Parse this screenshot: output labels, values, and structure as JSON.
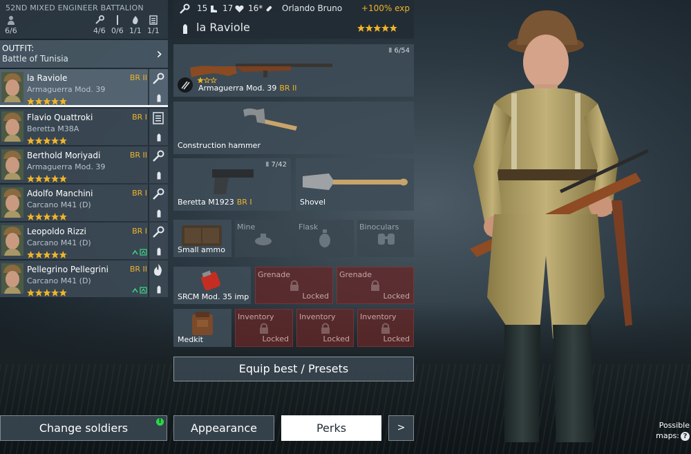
{
  "squad": {
    "title": "52ND MIXED ENGINEER BATTALION",
    "stats": [
      {
        "icon": "person-icon",
        "value": "6/6"
      },
      {
        "icon": "wrench-icon",
        "value": "4/6"
      },
      {
        "icon": "rifle-icon",
        "value": "0/6"
      },
      {
        "icon": "flame-icon",
        "value": "1/1"
      },
      {
        "icon": "list-icon",
        "value": "1/1"
      }
    ]
  },
  "outfit": {
    "label": "OUTFIT:",
    "value": "Battle of Tunisia"
  },
  "soldiers": [
    {
      "name": "la Raviole",
      "weapon": "Armaguerra Mod. 39",
      "br": "BR II",
      "role": "wrench-icon",
      "upgrade": ""
    },
    {
      "name": "Flavio Quattroki",
      "weapon": "Beretta M38A",
      "br": "BR I",
      "role": "list-icon",
      "upgrade": ""
    },
    {
      "name": "Berthold Moriyadi",
      "weapon": "Armaguerra Mod. 39",
      "br": "BR II",
      "role": "wrench-icon",
      "upgrade": ""
    },
    {
      "name": "Adolfo Manchini",
      "weapon": "Carcano M41 (D)",
      "br": "BR I",
      "role": "wrench-icon",
      "upgrade": ""
    },
    {
      "name": "Leopoldo Rizzi",
      "weapon": "Carcano M41 (D)",
      "br": "BR I",
      "role": "wrench-icon",
      "upgrade": "^"
    },
    {
      "name": "Pellegrino Pellegrini",
      "weapon": "Carcano M41 (D)",
      "br": "BR II",
      "role": "flame-icon",
      "upgrade": "^"
    }
  ],
  "change_soldiers": {
    "label": "Change soldiers",
    "badge": "!"
  },
  "topbar": {
    "stat1": "15",
    "stat2": "17",
    "stat3": "16*",
    "owner": "Orlando Bruno",
    "exp": "+100% exp"
  },
  "soldier": {
    "name": "la Raviole"
  },
  "loadout": {
    "primary": {
      "name": "Armaguerra Mod. 39",
      "br": "BR II",
      "ammo": "6/54"
    },
    "melee": {
      "name": "Construction hammer"
    },
    "sidearm": {
      "name": "Beretta M1923",
      "br": "BR I",
      "ammo": "7/42"
    },
    "tool": {
      "name": "Shovel"
    },
    "small1": {
      "name": "Small ammo"
    },
    "small2": {
      "name": "Mine"
    },
    "small3": {
      "name": "Flask"
    },
    "small4": {
      "name": "Binoculars"
    },
    "grenade1": {
      "name": "SRCM Mod. 35 imp"
    },
    "grenade2": {
      "name": "Grenade",
      "status": "Locked"
    },
    "grenade3": {
      "name": "Grenade",
      "status": "Locked"
    },
    "inv1": {
      "name": "Medkit"
    },
    "inv2": {
      "name": "Inventory",
      "status": "Locked"
    },
    "inv3": {
      "name": "Inventory",
      "status": "Locked"
    },
    "inv4": {
      "name": "Inventory",
      "status": "Locked"
    }
  },
  "buttons": {
    "equip_best": "Equip best / Presets",
    "appearance": "Appearance",
    "perks": "Perks",
    "next": ">"
  },
  "maps": {
    "line1": "Possible",
    "line2": "maps:",
    "help": "?"
  },
  "colors": {
    "br": "#f0b429",
    "star": "#f0b429",
    "locked": "#682626",
    "panel": "#3e4c58"
  }
}
